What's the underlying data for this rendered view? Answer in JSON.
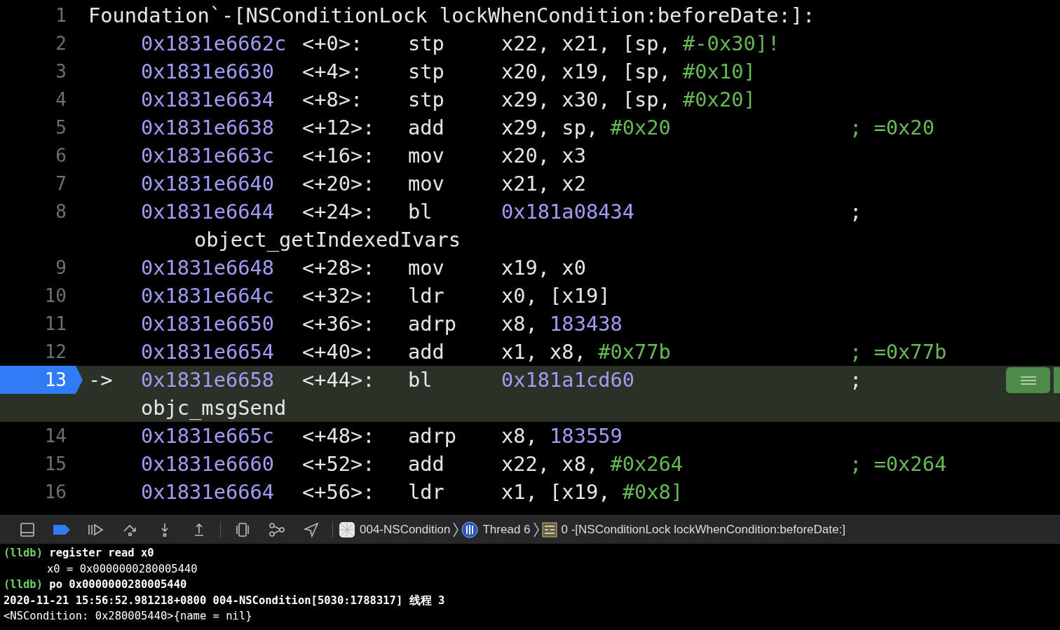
{
  "editor": {
    "header": {
      "line": "1",
      "text": "Foundation`-[NSConditionLock lockWhenCondition:beforeDate:]:"
    },
    "pc_marker": "->",
    "instructions": [
      {
        "line": "2",
        "address": "0x1831e6662c",
        "offset": "<+0>:",
        "mnemonic": "stp",
        "operands": [
          {
            "text": "x22, x21, [sp, ",
            "kind": "plain"
          },
          {
            "text": "#-0x30]!",
            "kind": "imm"
          }
        ],
        "current": false
      },
      {
        "line": "3",
        "address": "0x1831e6630",
        "offset": "<+4>:",
        "mnemonic": "stp",
        "operands": [
          {
            "text": "x20, x19, [sp, ",
            "kind": "plain"
          },
          {
            "text": "#0x10]",
            "kind": "imm"
          }
        ],
        "current": false
      },
      {
        "line": "4",
        "address": "0x1831e6634",
        "offset": "<+8>:",
        "mnemonic": "stp",
        "operands": [
          {
            "text": "x29, x30, [sp, ",
            "kind": "plain"
          },
          {
            "text": "#0x20]",
            "kind": "imm"
          }
        ],
        "current": false
      },
      {
        "line": "5",
        "address": "0x1831e6638",
        "offset": "<+12>:",
        "mnemonic": "add",
        "operands": [
          {
            "text": "x29, sp, ",
            "kind": "plain"
          },
          {
            "text": "#0x20",
            "kind": "imm"
          }
        ],
        "comment": "; =0x20",
        "current": false
      },
      {
        "line": "6",
        "address": "0x1831e663c",
        "offset": "<+16>:",
        "mnemonic": "mov",
        "operands": [
          {
            "text": "x20, x3",
            "kind": "plain"
          }
        ],
        "current": false
      },
      {
        "line": "7",
        "address": "0x1831e6640",
        "offset": "<+20>:",
        "mnemonic": "mov",
        "operands": [
          {
            "text": "x21, x2",
            "kind": "plain"
          }
        ],
        "current": false
      },
      {
        "line": "8",
        "address": "0x1831e6644",
        "offset": "<+24>:",
        "mnemonic": "bl",
        "operands": [
          {
            "text": "0x181a08434",
            "kind": "addr"
          }
        ],
        "comment": ";",
        "continuation": "object_getIndexedIvars",
        "current": false
      },
      {
        "line": "9",
        "address": "0x1831e6648",
        "offset": "<+28>:",
        "mnemonic": "mov",
        "operands": [
          {
            "text": "x19, x0",
            "kind": "plain"
          }
        ],
        "current": false
      },
      {
        "line": "10",
        "address": "0x1831e664c",
        "offset": "<+32>:",
        "mnemonic": "ldr",
        "operands": [
          {
            "text": "x0, [x19]",
            "kind": "plain"
          }
        ],
        "current": false
      },
      {
        "line": "11",
        "address": "0x1831e6650",
        "offset": "<+36>:",
        "mnemonic": "adrp",
        "operands": [
          {
            "text": "x8, ",
            "kind": "plain"
          },
          {
            "text": "183438",
            "kind": "addr"
          }
        ],
        "current": false
      },
      {
        "line": "12",
        "address": "0x1831e6654",
        "offset": "<+40>:",
        "mnemonic": "add",
        "operands": [
          {
            "text": "x1, x8, ",
            "kind": "plain"
          },
          {
            "text": "#0x77b",
            "kind": "imm"
          }
        ],
        "comment": "; =0x77b",
        "current": false
      },
      {
        "line": "13",
        "address": "0x1831e6658",
        "offset": "<+44>:",
        "mnemonic": "bl",
        "operands": [
          {
            "text": "0x181a1cd60",
            "kind": "addr"
          }
        ],
        "comment": ";",
        "continuation": "objc_msgSend",
        "current": true
      },
      {
        "line": "14",
        "address": "0x1831e665c",
        "offset": "<+48>:",
        "mnemonic": "adrp",
        "operands": [
          {
            "text": "x8, ",
            "kind": "plain"
          },
          {
            "text": "183559",
            "kind": "addr"
          }
        ],
        "current": false
      },
      {
        "line": "15",
        "address": "0x1831e6660",
        "offset": "<+52>:",
        "mnemonic": "add",
        "operands": [
          {
            "text": "x22, x8, ",
            "kind": "plain"
          },
          {
            "text": "#0x264",
            "kind": "imm"
          }
        ],
        "comment": "; =0x264",
        "current": false
      },
      {
        "line": "16",
        "address": "0x1831e6664",
        "offset": "<+56>:",
        "mnemonic": "ldr",
        "operands": [
          {
            "text": "x1, [x19, ",
            "kind": "plain"
          },
          {
            "text": "#0x8]",
            "kind": "imm"
          }
        ],
        "current": false
      }
    ]
  },
  "debug_bar": {
    "breadcrumbs": [
      {
        "kind": "app",
        "label": "004-NSCondition"
      },
      {
        "kind": "thread",
        "label": "Thread 6"
      },
      {
        "kind": "frame",
        "label": "0 -[NSConditionLock lockWhenCondition:beforeDate:]"
      }
    ]
  },
  "console": [
    {
      "kind": "command",
      "prompt": "(lldb)",
      "text": "register read x0"
    },
    {
      "kind": "output",
      "text": "x0 = 0x0000000280005440"
    },
    {
      "kind": "command",
      "prompt": "(lldb)",
      "text": "po 0x0000000280005440"
    },
    {
      "kind": "log",
      "text": "2020-11-21 15:56:52.981218+0800 004-NSCondition[5030:1788317] 线程 3"
    },
    {
      "kind": "plain",
      "text": "<NSCondition: 0x280005440>{name = nil}"
    }
  ]
}
